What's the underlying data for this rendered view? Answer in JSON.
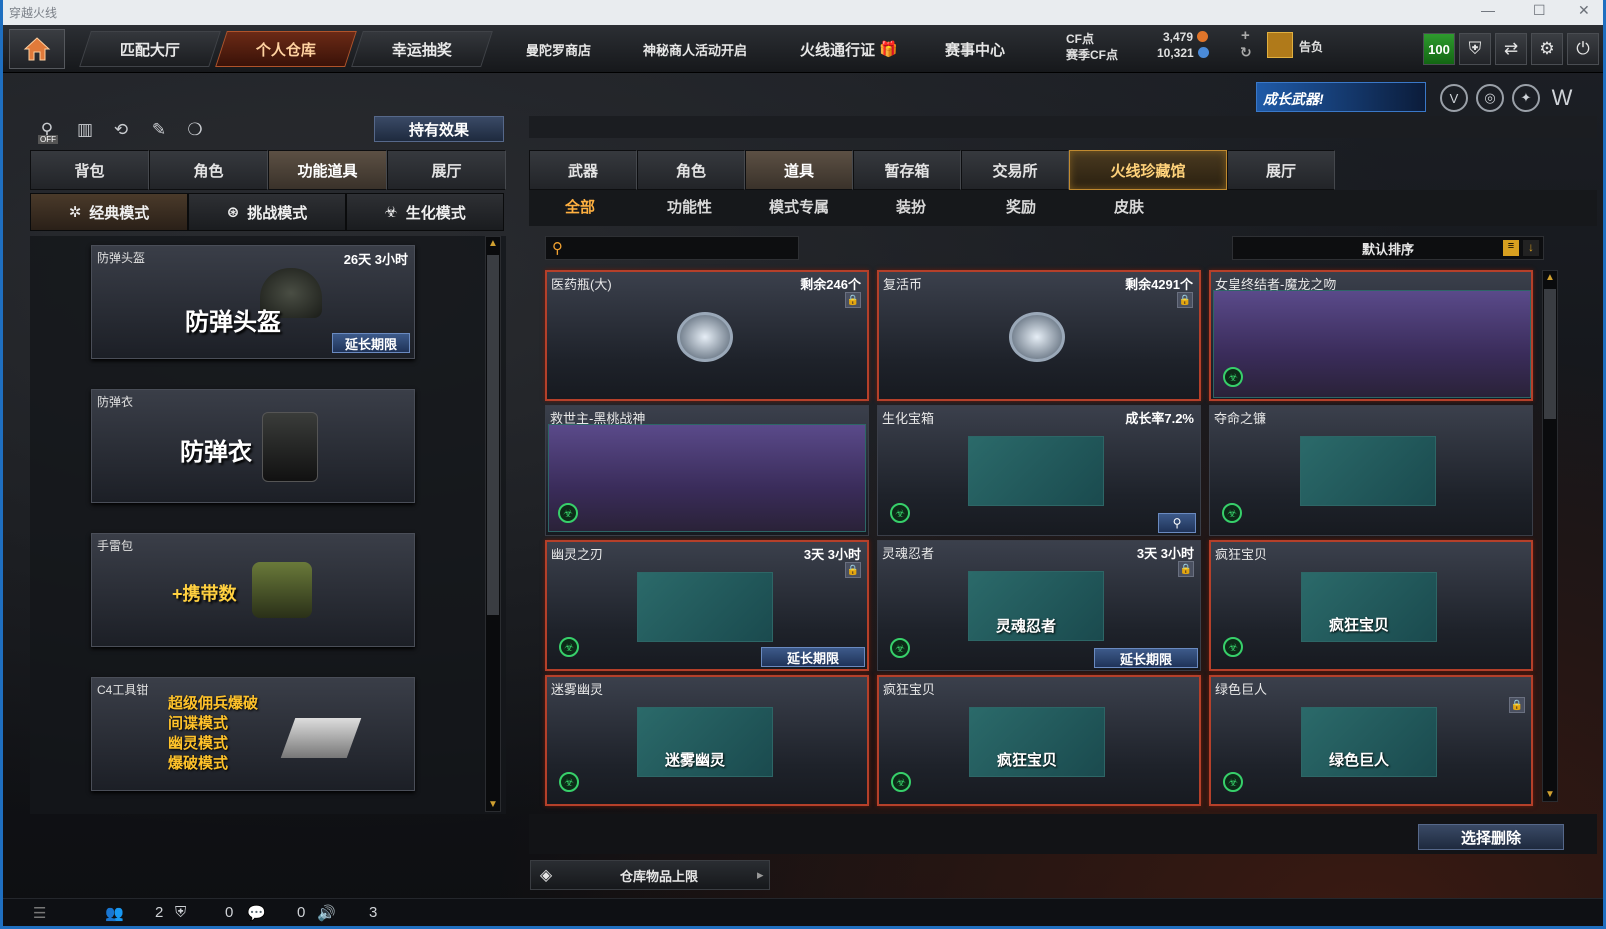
{
  "window": {
    "title": "穿越火线"
  },
  "nav": {
    "items": [
      "匹配大厅",
      "个人仓库",
      "幸运抽奖"
    ],
    "extra": [
      "曼陀罗商店",
      "神秘商人活动开启",
      "火线通行证",
      "赛事中心"
    ]
  },
  "currency": {
    "cf_label": "CF点",
    "cf_value": "3,479",
    "season_label": "赛季CF点",
    "season_value": "10,321",
    "rank": "告负"
  },
  "toolbar": {
    "level": "100"
  },
  "growth_banner": "成长武器!",
  "left": {
    "off_label": "OFF",
    "effect_button": "持有效果",
    "tabs": [
      "背包",
      "角色",
      "功能道具",
      "展厅"
    ],
    "modes": [
      "经典模式",
      "挑战模式",
      "生化模式"
    ],
    "items": [
      {
        "name": "防弹头盔",
        "time": "26天 3小时",
        "big": "防弹头盔",
        "extend": "延长期限"
      },
      {
        "name": "防弹衣",
        "big": "防弹衣"
      },
      {
        "name": "手雷包",
        "big": "+携带数"
      },
      {
        "name": "C4工具钳",
        "lines": [
          "超级佣兵爆破",
          "间谍模式",
          "幽灵模式",
          "爆破模式"
        ]
      }
    ]
  },
  "right": {
    "tabs": [
      "武器",
      "角色",
      "道具",
      "暂存箱",
      "交易所",
      "火线珍藏馆",
      "展厅"
    ],
    "subtabs": [
      "全部",
      "功能性",
      "模式专属",
      "装扮",
      "奖励",
      "皮肤"
    ],
    "sort": "默认排序",
    "cards": [
      {
        "name": "医药瓶(大)",
        "right": "剩余246个"
      },
      {
        "name": "复活币",
        "right": "剩余4291个"
      },
      {
        "name": "女皇终结者-魔龙之吻",
        "right": ""
      },
      {
        "name": "救世主-黑桃战神",
        "right": ""
      },
      {
        "name": "生化宝箱",
        "right": "成长率7.2%"
      },
      {
        "name": "夺命之镰",
        "right": ""
      },
      {
        "name": "幽灵之刃",
        "right": "3天 3小时",
        "extend": "延长期限"
      },
      {
        "name": "灵魂忍者",
        "right": "3天 3小时",
        "extend": "延长期限",
        "pic": "灵魂忍者"
      },
      {
        "name": "疯狂宝贝",
        "right": "",
        "pic": "疯狂宝贝"
      },
      {
        "name": "迷雾幽灵",
        "right": "",
        "pic": "迷雾幽灵"
      },
      {
        "name": "疯狂宝贝",
        "right": "",
        "pic": "疯狂宝贝"
      },
      {
        "name": "绿色巨人",
        "right": "",
        "pic": "绿色巨人"
      }
    ],
    "delete_button": "选择删除",
    "capacity": "仓库物品上限"
  },
  "status": {
    "a": "2",
    "b": "0",
    "c": "0",
    "d": "3"
  }
}
